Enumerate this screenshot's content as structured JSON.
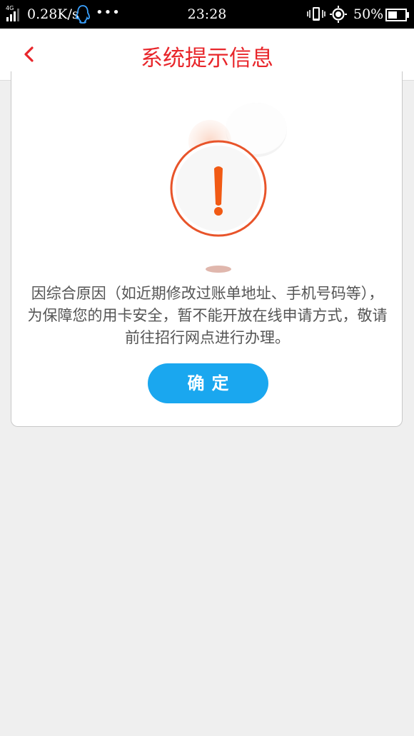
{
  "status_bar": {
    "network": "4G",
    "speed": "0.28K/s",
    "time": "23:28",
    "battery_percent": "50%",
    "icons": [
      "signal-icon",
      "qq-icon",
      "more-dots-icon",
      "vibrate-icon",
      "location-icon",
      "battery-icon"
    ]
  },
  "header": {
    "title": "系统提示信息",
    "back_icon": "chevron-left-icon"
  },
  "dialog": {
    "icon": "warning-exclamation-icon",
    "message": "因综合原因（如近期修改过账单地址、手机号码等），为保障您的用卡安全，暂不能开放在线申请方式，敬请前往招行网点进行办理。",
    "confirm_label": "确定"
  },
  "colors": {
    "title_red": "#e8262b",
    "button_blue": "#1aa7ef",
    "warning_orange": "#f05a14",
    "background": "#efefef"
  }
}
